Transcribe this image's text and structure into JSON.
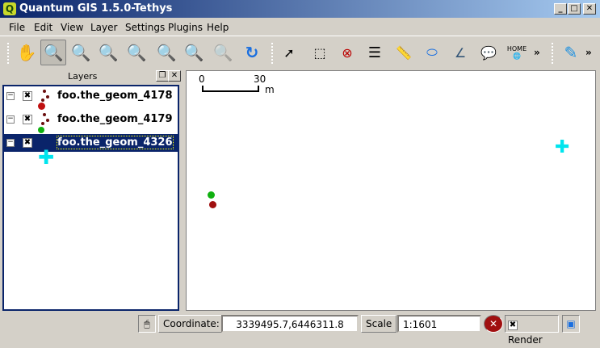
{
  "window": {
    "title": "Quantum GIS 1.5.0-Tethys",
    "min": "_",
    "max": "□",
    "close": "✕"
  },
  "menu": [
    "File",
    "Edit",
    "View",
    "Layer",
    "Settings",
    "Plugins",
    "Help"
  ],
  "toolbar": {
    "overflow1": "»",
    "overflow2": "»",
    "home_label": "HOME"
  },
  "layers_panel": {
    "title": "Layers",
    "layers": [
      {
        "name": "foo.the_geom_4178",
        "visible": true,
        "symbol_color": "#b01010",
        "selected": false
      },
      {
        "name": "foo.the_geom_4179",
        "visible": true,
        "symbol_color": "#10b010",
        "selected": false
      },
      {
        "name": "foo.the_geom_4326",
        "visible": true,
        "symbol_color": "#00e5ee",
        "selected": true
      }
    ]
  },
  "map": {
    "scalebar": {
      "start": "0",
      "end": "30",
      "unit": "m"
    }
  },
  "status": {
    "coordinate_label": "Coordinate:",
    "coordinate": "3339495.7,6446311.8",
    "scale_label": "Scale",
    "scale": "1:1601",
    "render_label": "Render",
    "render_checked": true
  }
}
